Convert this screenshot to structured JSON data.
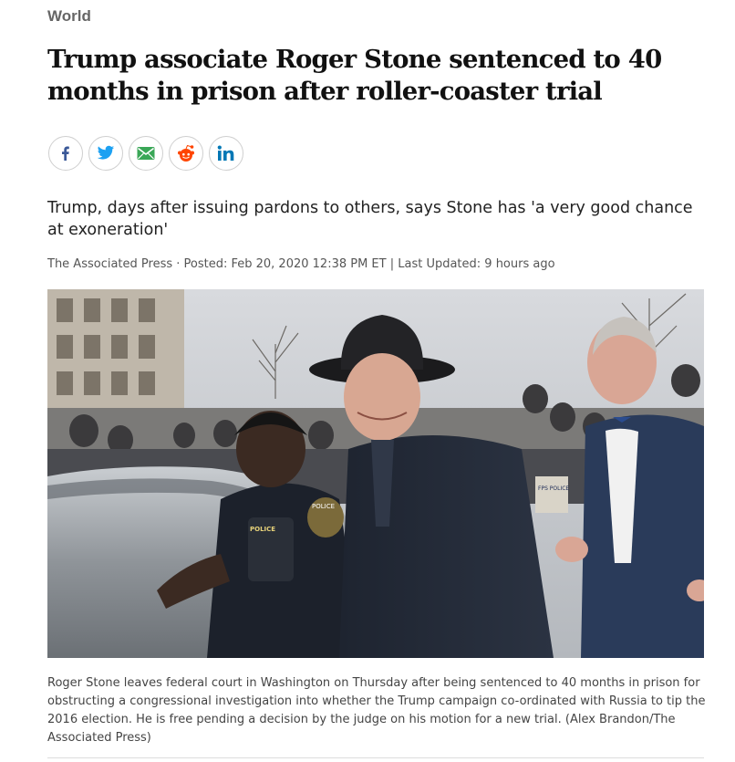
{
  "section": {
    "label": "World"
  },
  "article": {
    "headline": "Trump associate Roger Stone sentenced to 40 months in prison after roller-coaster trial",
    "deck": "Trump, days after issuing pardons to others, says Stone has 'a very good chance at exoneration'",
    "byline": "The Associated Press · Posted: Feb 20, 2020 12:38 PM ET | Last Updated: 9 hours ago",
    "photo_caption": "Roger Stone leaves federal court in Washington on Thursday after being sentenced to 40 months in prison for obstructing a congressional investigation into whether the Trump campaign co-ordinated with Russia to tip the 2016 election. He is free pending a decision by the judge on his motion for a new trial. (Alex Brandon/The Associated Press)",
    "photo_signs": {
      "police_patch": "POLICE",
      "vest_text": "POLICE",
      "sign_text": "FPS POLICE"
    }
  },
  "share": {
    "buttons": [
      {
        "name": "facebook",
        "icon": "facebook-icon",
        "color": "#3b5998"
      },
      {
        "name": "twitter",
        "icon": "twitter-icon",
        "color": "#1da1f2"
      },
      {
        "name": "email",
        "icon": "email-icon",
        "color": "#3aa757"
      },
      {
        "name": "reddit",
        "icon": "reddit-icon",
        "color": "#ff4500"
      },
      {
        "name": "linkedin",
        "icon": "linkedin-icon",
        "color": "#0077b5"
      }
    ]
  }
}
